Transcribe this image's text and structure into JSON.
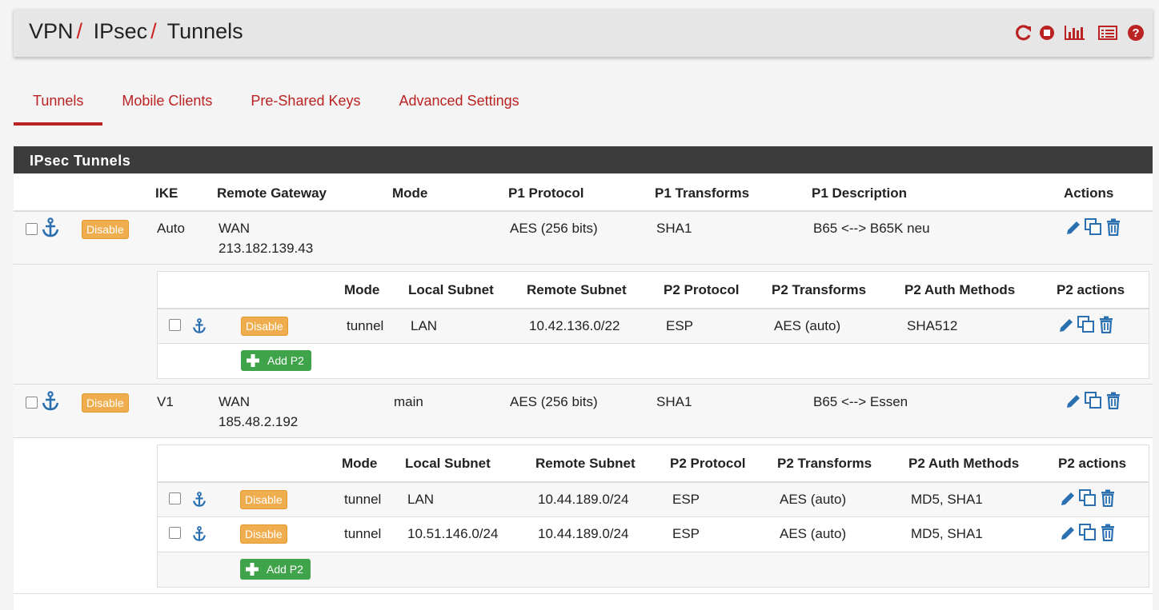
{
  "breadcrumb": [
    "VPN",
    "IPsec",
    "Tunnels"
  ],
  "breadcrumb_sep": "/",
  "header_icons": [
    "reload-icon",
    "stop-icon",
    "bar-chart-icon",
    "log-list-icon",
    "help-icon"
  ],
  "tabs": [
    {
      "label": "Tunnels",
      "active": true
    },
    {
      "label": "Mobile Clients"
    },
    {
      "label": "Pre-Shared Keys"
    },
    {
      "label": "Advanced Settings"
    }
  ],
  "panel_title": "IPsec Tunnels",
  "p1_headers": {
    "ike": "IKE",
    "gateway": "Remote Gateway",
    "mode": "Mode",
    "protocol": "P1 Protocol",
    "transforms": "P1 Transforms",
    "description": "P1 Description",
    "actions": "Actions"
  },
  "p2_headers": {
    "mode": "Mode",
    "local": "Local Subnet",
    "remote": "Remote Subnet",
    "protocol": "P2 Protocol",
    "transforms": "P2 Transforms",
    "auth": "P2 Auth Methods",
    "actions": "P2 actions"
  },
  "disable_label": "Disable",
  "add_p2_label": "Add P2",
  "tunnels": [
    {
      "ike": "Auto",
      "gateway_iface": "WAN",
      "gateway_ip": "213.182.139.43",
      "mode": "",
      "protocol": "AES (256 bits)",
      "transforms": "SHA1",
      "description": "B65 <--> B65K neu",
      "p2": [
        {
          "mode": "tunnel",
          "local": "LAN",
          "remote": "10.42.136.0/22",
          "protocol": "ESP",
          "transforms": "AES (auto)",
          "auth": "SHA512"
        }
      ]
    },
    {
      "ike": "V1",
      "gateway_iface": "WAN",
      "gateway_ip": "185.48.2.192",
      "mode": "main",
      "protocol": "AES (256 bits)",
      "transforms": "SHA1",
      "description": "B65 <--> Essen",
      "p2": [
        {
          "mode": "tunnel",
          "local": "LAN",
          "remote": "10.44.189.0/24",
          "protocol": "ESP",
          "transforms": "AES (auto)",
          "auth": "MD5, SHA1"
        },
        {
          "mode": "tunnel",
          "local": "10.51.146.0/24",
          "remote": "10.44.189.0/24",
          "protocol": "ESP",
          "transforms": "AES (auto)",
          "auth": "MD5, SHA1"
        }
      ]
    }
  ],
  "colors": {
    "accent": "#b22222",
    "icon_blue": "#2a6fb0",
    "disable": "#f0ad4e",
    "add": "#3fa34a"
  }
}
